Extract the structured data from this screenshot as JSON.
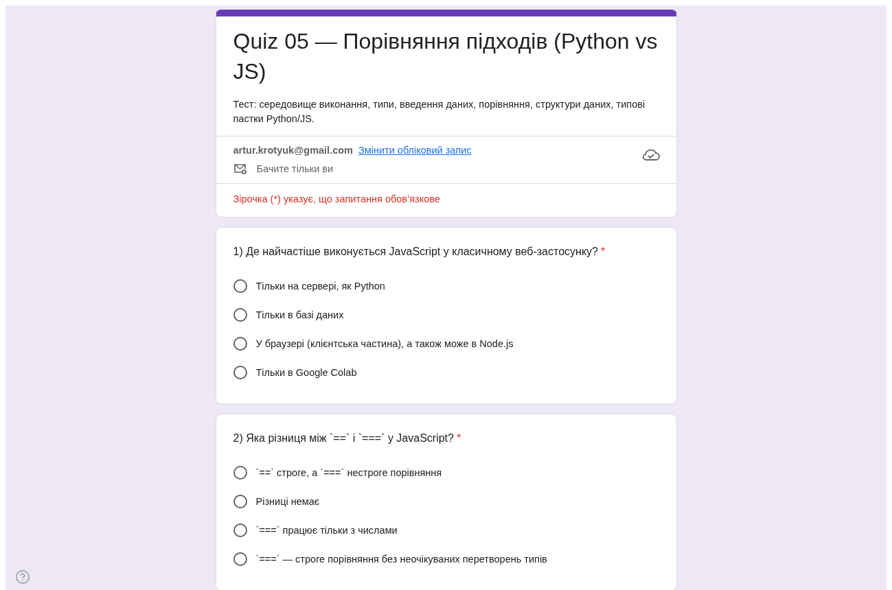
{
  "form": {
    "title": "Quiz 05 — Порівняння підходів (Python vs JS)",
    "description": "Тест: середовище виконання, типи, введення даних, порівняння, структури даних, типові пастки Python/JS.",
    "account": {
      "email": "artur.krotyuk@gmail.com",
      "switch_link": "Змінити обліковий запис",
      "visibility": "Бачите тільки ви"
    },
    "required_note": "Зірочка (*) указує, що запитання обов’язкове"
  },
  "questions": [
    {
      "title": "1) Де найчастіше виконується JavaScript у класичному веб-застосунку?",
      "required_mark": "*",
      "options": [
        {
          "label": "Тільки на сервері, як Python",
          "selected": false
        },
        {
          "label": "Тільки в базі даних",
          "selected": false
        },
        {
          "label": "У браузері (клієнтська частина), а також може в Node.js",
          "selected": false
        },
        {
          "label": "Тільки в Google Colab",
          "selected": false
        }
      ]
    },
    {
      "title": "2) Яка різниця між `==` і `===` у JavaScript?",
      "required_mark": "*",
      "options": [
        {
          "label": "`==` строге, а `===` нестроге порівняння",
          "selected": false
        },
        {
          "label": "Різниці немає",
          "selected": false
        },
        {
          "label": "`===` працює тільки з числами",
          "selected": false
        },
        {
          "label": "`===` — строге порівняння без неочікуваних перетворень типів",
          "selected": false
        }
      ]
    }
  ]
}
